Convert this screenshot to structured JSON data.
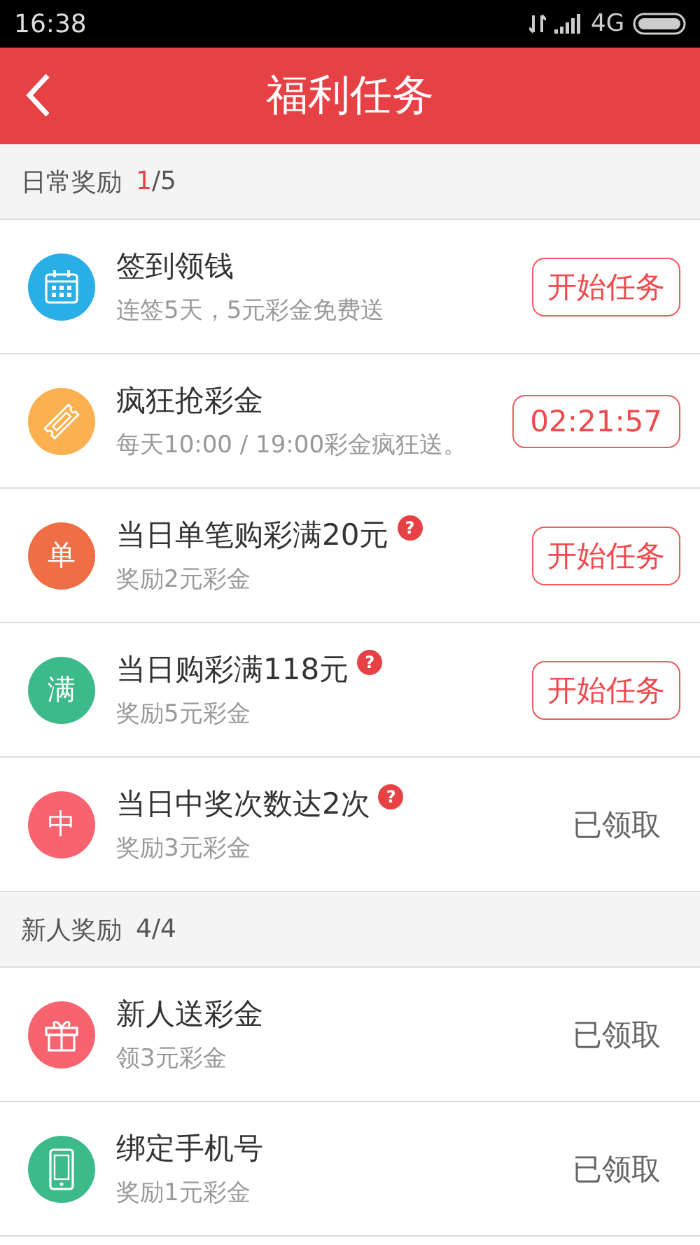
{
  "status_bar": {
    "time": "16:38",
    "network": "4G"
  },
  "header": {
    "title": "福利任务"
  },
  "sections": [
    {
      "title": "日常奖励",
      "count_done": "1",
      "count_rest": "/5",
      "highlight": true,
      "tasks": [
        {
          "kind": "calendar",
          "color": "#2aaee6",
          "title": "签到领钱",
          "subtitle": "连签5天，5元彩金免费送",
          "action": {
            "kind": "button",
            "label": "开始任务"
          }
        },
        {
          "kind": "ticket",
          "color": "#fbb150",
          "title": "疯狂抢彩金",
          "subtitle": "每天10:00 / 19:00彩金疯狂送。",
          "action": {
            "kind": "timer",
            "label": "02:21:57"
          }
        },
        {
          "kind": "glyph",
          "glyph": "单",
          "color": "#f06e46",
          "title": "当日单笔购彩满20元",
          "help_mark": "?",
          "subtitle": "奖励2元彩金",
          "action": {
            "kind": "button",
            "label": "开始任务"
          }
        },
        {
          "kind": "glyph",
          "glyph": "满",
          "color": "#3dba8a",
          "title": "当日购彩满118元",
          "help_mark": "?",
          "subtitle": "奖励5元彩金",
          "action": {
            "kind": "button",
            "label": "开始任务"
          }
        },
        {
          "kind": "glyph",
          "glyph": "中",
          "color": "#f7636e",
          "title": "当日中奖次数达2次",
          "help_mark": "?",
          "subtitle": "奖励3元彩金",
          "action": {
            "kind": "claimed",
            "label": "已领取"
          }
        }
      ]
    },
    {
      "title": "新人奖励",
      "count_done": "4",
      "count_rest": "/4",
      "highlight": false,
      "tasks": [
        {
          "kind": "gift",
          "color": "#f7636e",
          "title": "新人送彩金",
          "subtitle": "领3元彩金",
          "action": {
            "kind": "claimed",
            "label": "已领取"
          }
        },
        {
          "kind": "phone",
          "color": "#3dba8a",
          "title": "绑定手机号",
          "subtitle": "奖励1元彩金",
          "action": {
            "kind": "claimed",
            "label": "已领取"
          }
        }
      ]
    }
  ]
}
